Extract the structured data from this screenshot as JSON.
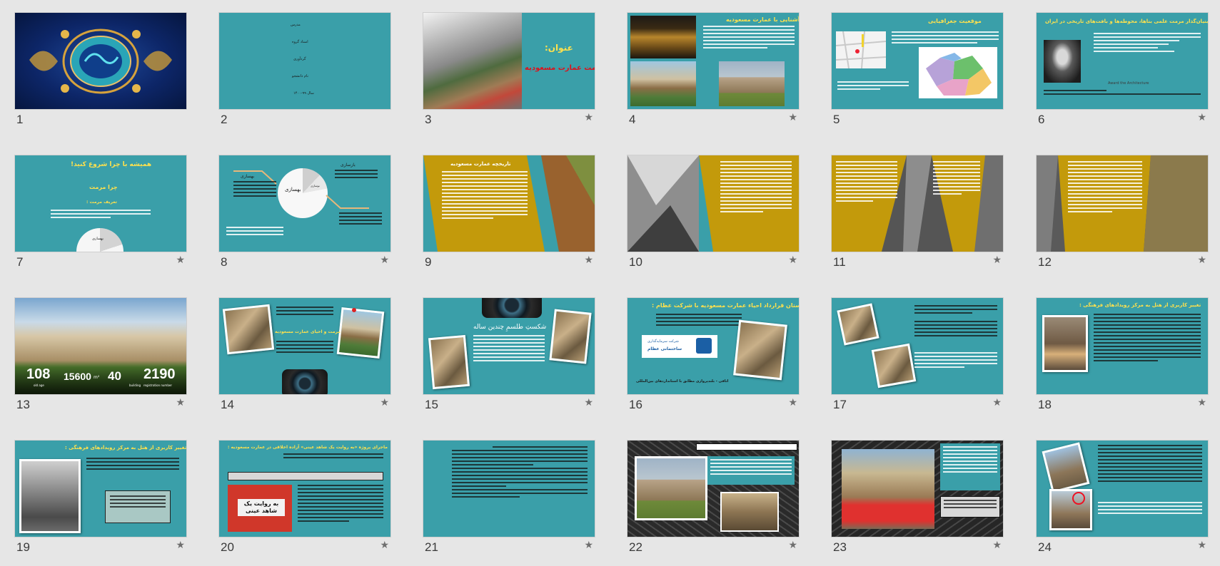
{
  "slides": [
    {
      "number": "1"
    },
    {
      "number": "2",
      "starred": false,
      "lines": [
        "مدرس",
        "استاد گروه",
        "گردآوری",
        "نام دانشجو",
        "سال ۹۹-۱۴۰۰"
      ]
    },
    {
      "number": "3",
      "starred": true,
      "label": "عنوان:",
      "title": "مرمت عمارت مسعودیه"
    },
    {
      "number": "4",
      "starred": true,
      "title": "آشنایی با عمارت مسعودیه"
    },
    {
      "number": "5",
      "starred": false,
      "title": "موقعیت جغرافیایی"
    },
    {
      "number": "6",
      "starred": true,
      "title": "بنیان‌گذار مرمت علمی بناها، محوطه‌ها و بافت‌های تاریخی در ایران",
      "caption": "Award the Architecture"
    },
    {
      "number": "7",
      "starred": true,
      "title": "همیشه با چرا شروع کنید!",
      "subtitle": "چرا مرمت",
      "subtitle2": "تعریف مرمت :",
      "pie_label": "بهسازی"
    },
    {
      "number": "8",
      "starred": true,
      "pie_main": "بهسازی",
      "pie_side": "نوسازی",
      "label_left": "بهسازی",
      "label_right": "بازسازی"
    },
    {
      "number": "9",
      "starred": true,
      "title": "تاریخچه عمارت مسعودیه"
    },
    {
      "number": "10",
      "starred": true
    },
    {
      "number": "11",
      "starred": true
    },
    {
      "number": "12",
      "starred": true
    },
    {
      "number": "13",
      "starred": true,
      "stats": [
        {
          "value": "108",
          "label": "old age"
        },
        {
          "value": "15600",
          "label": "m²"
        },
        {
          "value": "40",
          "label": "building"
        },
        {
          "value": "2190",
          "label": "registration number"
        }
      ]
    },
    {
      "number": "14",
      "starred": true,
      "highlight": "مرمت و احیای عمارت مسعودیه"
    },
    {
      "number": "15",
      "starred": true,
      "title": "شکستِ طلسمِ چندین ساله"
    },
    {
      "number": "16",
      "starred": true,
      "title": "داستان قرارداد احیاء عمارت مسعودیه با شرکت عظام :",
      "logo_line1": "شرکت سرمایه‌گذاری",
      "logo_line2": "ساختمانی عظام",
      "footer": "اتاقی - بلند‌پروازی مطابق با استانداردهای بین‌المللی"
    },
    {
      "number": "17",
      "starred": true
    },
    {
      "number": "18",
      "starred": true,
      "title": "تغییر کاربری از هتل به مرکز رویدادهای فرهنگی :"
    },
    {
      "number": "19",
      "starred": true,
      "title": "تغییر کاربری از هتل به مرکز رویدادهای فرهنگی :"
    },
    {
      "number": "20",
      "starred": true,
      "title": "ماجرای پروژه «به روایت یک شاهد عینی» آزاده اخلاقی در عمارت مسعودیه :",
      "poster": "به روایت یک شاهد عینی"
    },
    {
      "number": "21",
      "starred": true
    },
    {
      "number": "22",
      "starred": true
    },
    {
      "number": "23",
      "starred": true
    },
    {
      "number": "24",
      "starred": true
    }
  ],
  "colors": {
    "background": "#e6e6e6",
    "slide_teal": "#3a9fa9",
    "gold": "#c39a0b",
    "yellow_text": "#ffe14d",
    "red_text": "#d9141e"
  },
  "icons": {
    "star": "star-icon"
  }
}
